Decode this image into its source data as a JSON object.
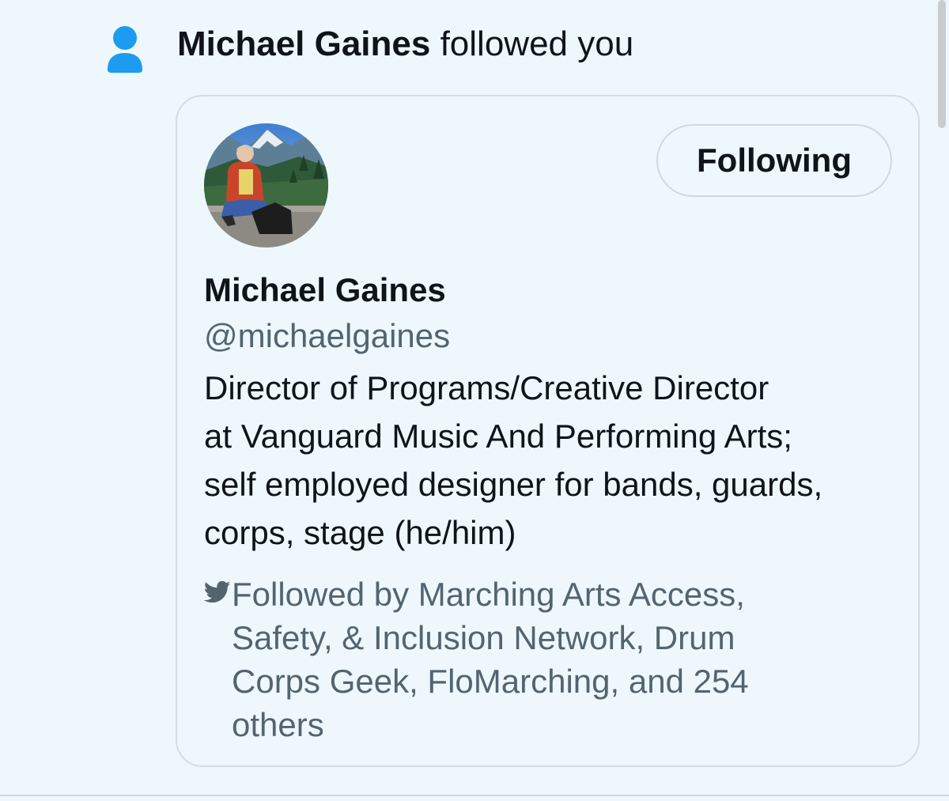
{
  "notification": {
    "actor_name": "Michael Gaines",
    "action_text": " followed you",
    "icon": "person-icon"
  },
  "user_card": {
    "avatar_icon": "profile-photo",
    "follow_button_label": "Following",
    "display_name": "Michael Gaines",
    "handle": "@michaelgaines",
    "bio_lines": [
      "Director of Programs/Creative Director",
      "at Vanguard Music And Performing Arts;",
      "self employed designer for bands, guards,",
      "corps, stage (he/him)"
    ],
    "followed_by_icon": "twitter-bird-icon",
    "followed_by_lines": [
      "Followed by Marching Arts Access,",
      "Safety, & Inclusion Network, Drum",
      "Corps Geek, FloMarching, and 254",
      "others"
    ]
  },
  "colors": {
    "background": "#eef8fc",
    "accent": "#1d9bf0",
    "primary_text": "#0f1419",
    "secondary_text": "#536471",
    "border": "#d4dde2"
  }
}
